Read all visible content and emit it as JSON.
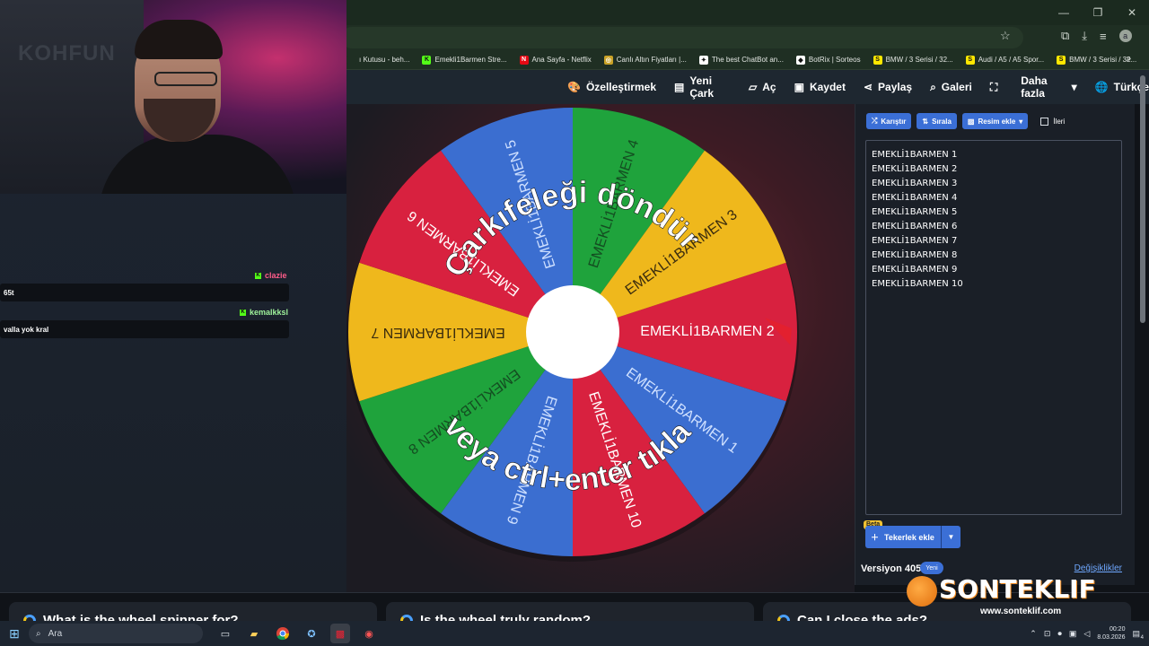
{
  "browser": {
    "window_controls": [
      "—",
      "❐",
      "✕"
    ],
    "bookmarks": [
      {
        "icon": "folder-icon",
        "label": "ı Kutusu - beh...",
        "color": "#1f2f23",
        "glyph": ""
      },
      {
        "icon": "kick-icon",
        "label": "Emekli1Barmen Stre...",
        "color": "#53fc18",
        "glyph": "K"
      },
      {
        "icon": "netflix-icon",
        "label": "Ana Sayfa - Netflix",
        "color": "#e50914",
        "glyph": "N"
      },
      {
        "icon": "gold-icon",
        "label": "Canlı Altın Fiyatları |...",
        "color": "#c9a227",
        "glyph": "◎"
      },
      {
        "icon": "chatbot-icon",
        "label": "The best ChatBot an...",
        "color": "#ffffff",
        "glyph": "✦"
      },
      {
        "icon": "botrix-icon",
        "label": "BotRix | Sorteos",
        "color": "#ffffff",
        "glyph": "◆"
      },
      {
        "icon": "sahibinden-icon",
        "label": "BMW / 3 Serisi / 32...",
        "color": "#ffe800",
        "glyph": "S"
      },
      {
        "icon": "sahibinden-icon",
        "label": "Audi / A5 / A5 Spor...",
        "color": "#ffe800",
        "glyph": "S"
      },
      {
        "icon": "sahibinden-icon",
        "label": "BMW / 3 Serisi / 32...",
        "color": "#ffe800",
        "glyph": "S"
      }
    ],
    "bookmarks_more": "»"
  },
  "sitebar": {
    "items": [
      {
        "icon": "palette-icon",
        "glyph": "🎨",
        "label": "Özelleştirmek"
      },
      {
        "icon": "file-icon",
        "glyph": "▤",
        "label": "Yeni Çark"
      },
      {
        "icon": "folder-open-icon",
        "glyph": "▱",
        "label": "Aç"
      },
      {
        "icon": "save-icon",
        "glyph": "▣",
        "label": "Kaydet"
      },
      {
        "icon": "share-icon",
        "glyph": "⋖",
        "label": "Paylaş"
      },
      {
        "icon": "search-icon",
        "glyph": "⌕",
        "label": "Galeri"
      },
      {
        "icon": "fullscreen-icon",
        "glyph": "⛶",
        "label": ""
      },
      {
        "icon": "chevron-down-icon",
        "glyph": "▾",
        "label": "Daha fazla"
      },
      {
        "icon": "globe-icon",
        "glyph": "🌐",
        "label": "Türkçe"
      }
    ]
  },
  "chat": [
    {
      "user": "clazie",
      "color": "#ff5c8a",
      "message": "65t"
    },
    {
      "user": "kemalkksl",
      "color": "#9ff29b",
      "message": "valla yok kral"
    }
  ],
  "webcam": {
    "logo": "KOHFUN"
  },
  "wheel": {
    "overlay_top": "Çarkıfeleği döndür",
    "overlay_bottom": "veya ctrl+enter tıkla",
    "segments": [
      {
        "label": "EMEKLİ1BARMEN  2",
        "color": "#d8213f"
      },
      {
        "label": "EMEKLİ1BARMEN  1",
        "color": "#3b6ed0"
      },
      {
        "label": "EMEKLİ1BARMEN  10",
        "color": "#d8213f"
      },
      {
        "label": "EMEKLİ1BARMEN  9",
        "color": "#3b6ed0"
      },
      {
        "label": "EMEKLİ1BARMEN  8",
        "color": "#1fa33c"
      },
      {
        "label": "EMEKLİ1BARMEN  7",
        "color": "#efb81c"
      },
      {
        "label": "EMEKLİ1BARMEN  6",
        "color": "#d8213f"
      },
      {
        "label": "EMEKLİ1BARMEN  5",
        "color": "#3b6ed0"
      },
      {
        "label": "EMEKLİ1BARMEN  4",
        "color": "#1fa33c"
      },
      {
        "label": "EMEKLİ1BARMEN  3",
        "color": "#efb81c"
      }
    ]
  },
  "panel": {
    "shuffle": "Karıştır",
    "sort": "Sırala",
    "add_image": "Resim ekle",
    "advanced": "İleri",
    "entries": [
      "EMEKLİ1BARMEN  1",
      "EMEKLİ1BARMEN  2",
      "EMEKLİ1BARMEN  3",
      "EMEKLİ1BARMEN  4",
      "EMEKLİ1BARMEN  5",
      "EMEKLİ1BARMEN  6",
      "EMEKLİ1BARMEN  7",
      "EMEKLİ1BARMEN  8",
      "EMEKLİ1BARMEN  9",
      "EMEKLİ1BARMEN  10"
    ],
    "beta": "Beta",
    "add_wheel": "Tekerlek ekle",
    "version": "Versiyon 405",
    "version_badge": "Yeni",
    "changes": "Değişiklikler"
  },
  "brand": {
    "name": "SONTEKLIF",
    "url": "www.sonteklif.com"
  },
  "faq": [
    "What is the wheel spinner for?",
    "Is the wheel truly random?",
    "Can I close the ads?"
  ],
  "taskbar": {
    "search_placeholder": "Ara",
    "time": "00:20",
    "date": "8.03.2026",
    "notifications": "4"
  }
}
